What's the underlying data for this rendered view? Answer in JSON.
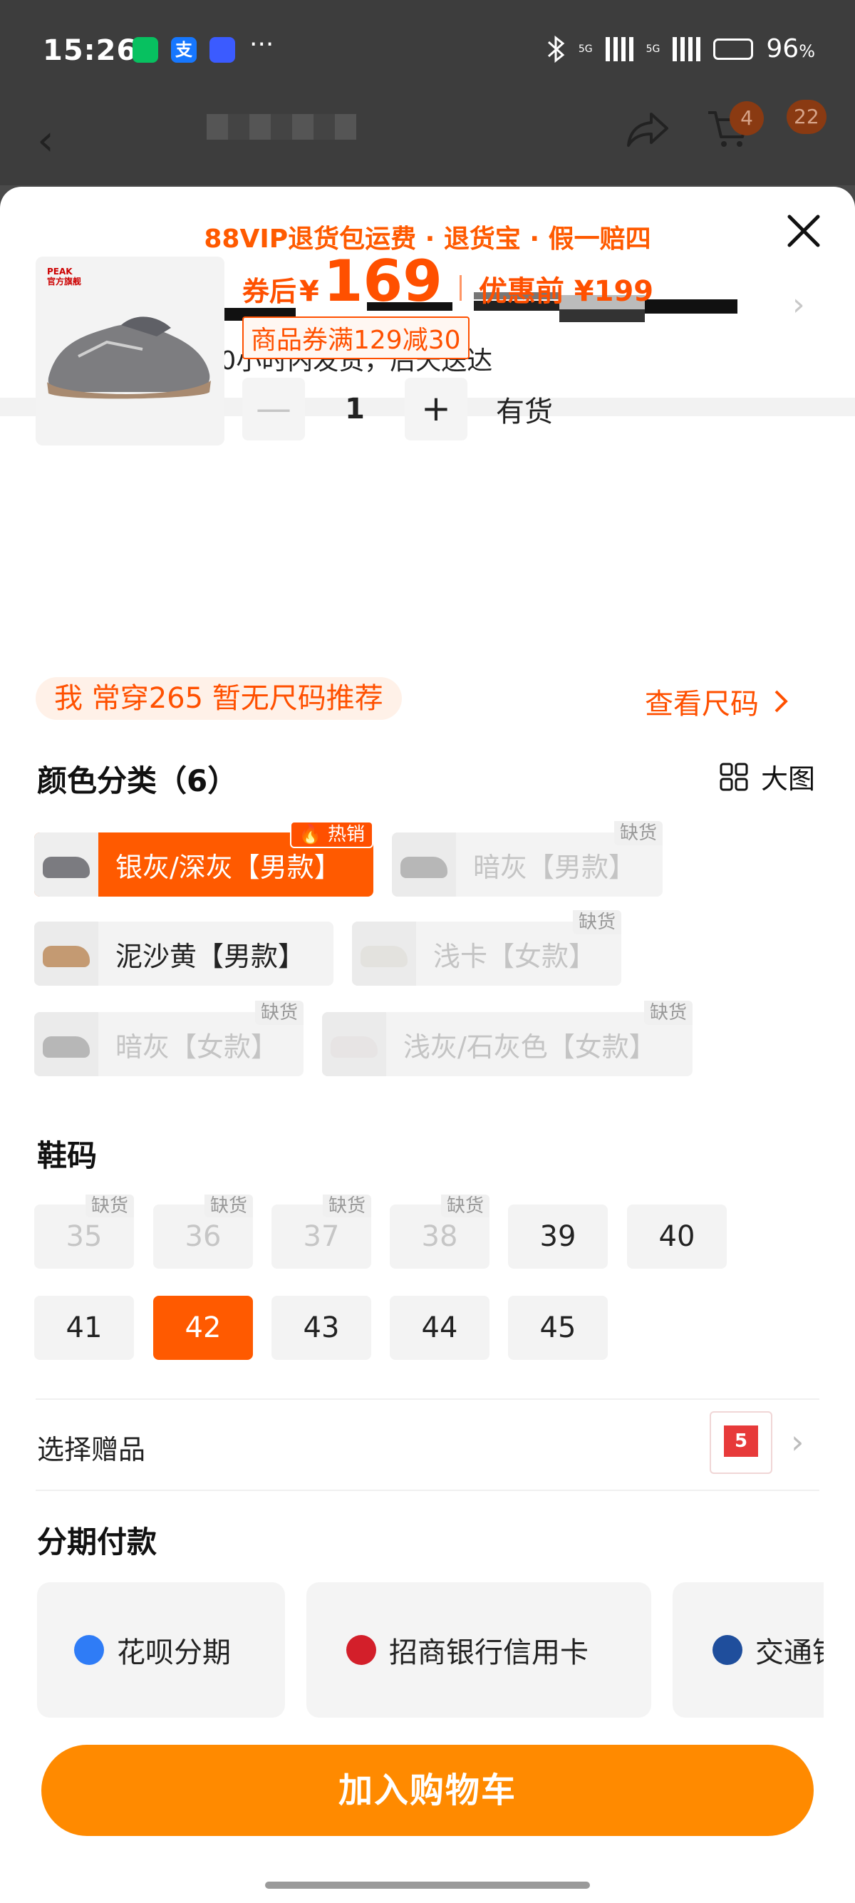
{
  "status": {
    "time": "15:26",
    "net1": "5G",
    "net2": "5G",
    "battery": "96",
    "battery_unit": "%",
    "dots": "···",
    "alipay_glyph": "支"
  },
  "nav": {
    "cart_badge": "4",
    "msg_badge": "22"
  },
  "sheet": {
    "promo": "88VIP退货包运费 · 退货宝 · 假一赔四",
    "shipping": "包邮  预计20小时内发货，后天送达"
  },
  "product": {
    "logo_text": "PEAK",
    "logo_sub": "官方旗舰",
    "after_label": "券后",
    "currency": "¥",
    "price": "169",
    "before_label": "优惠前",
    "before_price": "¥199",
    "coupon": "商品券满129减30",
    "minus": "—",
    "plus": "+",
    "quantity": "1",
    "stock": "有货"
  },
  "size_hint": {
    "text": "我 常穿265 暂无尺码推荐",
    "link": "查看尺码"
  },
  "color_section": {
    "title": "颜色分类（6）",
    "big_view": "大图",
    "hot_tag": "热销",
    "out_tag": "缺货",
    "options": [
      {
        "label": "银灰/深灰【男款】"
      },
      {
        "label": "暗灰【男款】"
      },
      {
        "label": "泥沙黄【男款】"
      },
      {
        "label": "浅卡【女款】"
      },
      {
        "label": "暗灰【女款】"
      },
      {
        "label": "浅灰/石灰色【女款】"
      }
    ]
  },
  "size_section": {
    "title": "鞋码",
    "sizes": [
      "35",
      "36",
      "37",
      "38",
      "39",
      "40",
      "41",
      "42",
      "43",
      "44",
      "45"
    ],
    "selected": "42"
  },
  "gift": {
    "label": "选择赠品",
    "img_text": "5"
  },
  "installment": {
    "title": "分期付款",
    "options": [
      {
        "label": "花呗分期"
      },
      {
        "label": "招商银行信用卡"
      },
      {
        "label": "交通银行"
      }
    ]
  },
  "actions": {
    "add_to_cart": "加入购物车"
  },
  "colors": {
    "accent": "#ff5a00",
    "cta": "#ff8a00"
  }
}
